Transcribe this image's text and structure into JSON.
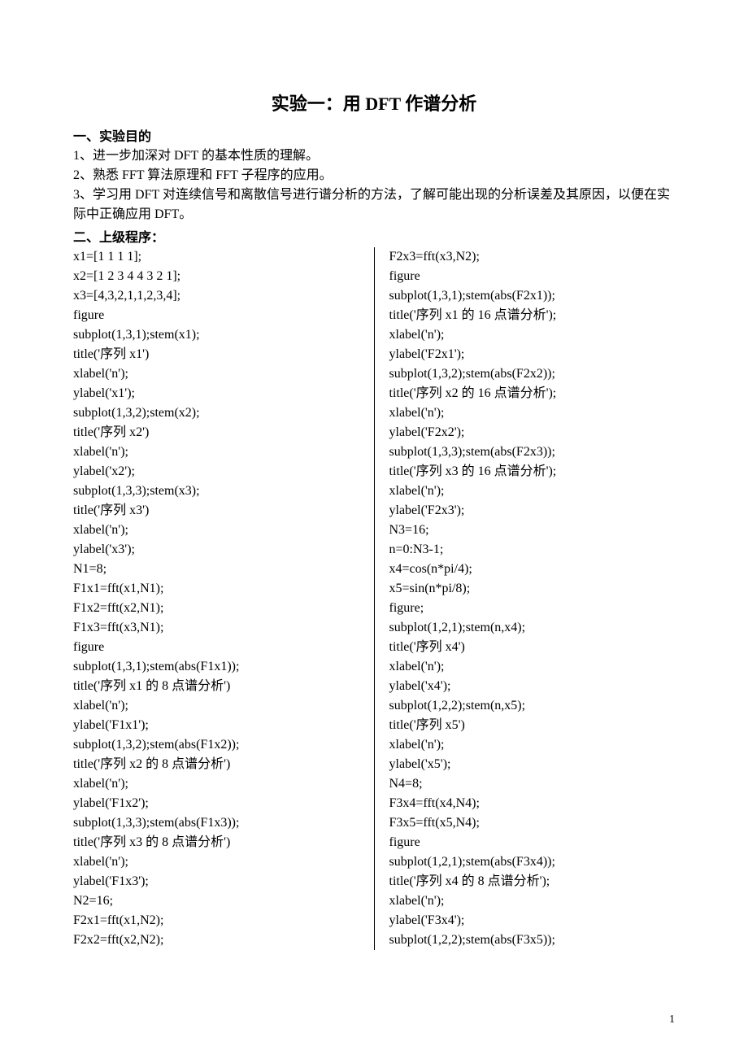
{
  "title": "实验一：用 DFT 作谱分析",
  "section1_heading": "一、实验目的",
  "objectives": [
    "1、进一步加深对 DFT 的基本性质的理解。",
    "2、熟悉 FFT 算法原理和 FFT 子程序的应用。",
    "3、学习用 DFT 对连续信号和离散信号进行谱分析的方法，了解可能出现的分析误差及其原因，以便在实际中正确应用 DFT。"
  ],
  "section2_heading": "二、上级程序：",
  "code_left": "x1=[1 1 1 1];\nx2=[1 2 3 4 4 3 2 1];\nx3=[4,3,2,1,1,2,3,4];\nfigure\nsubplot(1,3,1);stem(x1);\ntitle('序列 x1')\nxlabel('n');\nylabel('x1');\nsubplot(1,3,2);stem(x2);\ntitle('序列 x2')\nxlabel('n');\nylabel('x2');\nsubplot(1,3,3);stem(x3);\ntitle('序列 x3')\nxlabel('n');\nylabel('x3');\nN1=8;\nF1x1=fft(x1,N1);\nF1x2=fft(x2,N1);\nF1x3=fft(x3,N1);\nfigure\nsubplot(1,3,1);stem(abs(F1x1));\ntitle('序列 x1 的 8 点谱分析')\nxlabel('n');\nylabel('F1x1');\nsubplot(1,3,2);stem(abs(F1x2));\ntitle('序列 x2 的 8 点谱分析')\nxlabel('n');\nylabel('F1x2');\nsubplot(1,3,3);stem(abs(F1x3));\ntitle('序列 x3 的 8 点谱分析')\nxlabel('n');\nylabel('F1x3');\nN2=16;\nF2x1=fft(x1,N2);\nF2x2=fft(x2,N2);",
  "code_right": "F2x3=fft(x3,N2);\nfigure\nsubplot(1,3,1);stem(abs(F2x1));\ntitle('序列 x1 的 16 点谱分析');\nxlabel('n');\nylabel('F2x1');\nsubplot(1,3,2);stem(abs(F2x2));\ntitle('序列 x2 的 16 点谱分析');\nxlabel('n');\nylabel('F2x2');\nsubplot(1,3,3);stem(abs(F2x3));\ntitle('序列 x3 的 16 点谱分析');\nxlabel('n');\nylabel('F2x3');\nN3=16;\nn=0:N3-1;\nx4=cos(n*pi/4);\nx5=sin(n*pi/8);\nfigure;\nsubplot(1,2,1);stem(n,x4);\ntitle('序列 x4')\nxlabel('n');\nylabel('x4');\nsubplot(1,2,2);stem(n,x5);\ntitle('序列 x5')\nxlabel('n');\nylabel('x5');\nN4=8;\nF3x4=fft(x4,N4);\nF3x5=fft(x5,N4);\nfigure\nsubplot(1,2,1);stem(abs(F3x4));\ntitle('序列 x4 的 8 点谱分析');\nxlabel('n');\nylabel('F3x4');\nsubplot(1,2,2);stem(abs(F3x5));",
  "page_number": "1"
}
